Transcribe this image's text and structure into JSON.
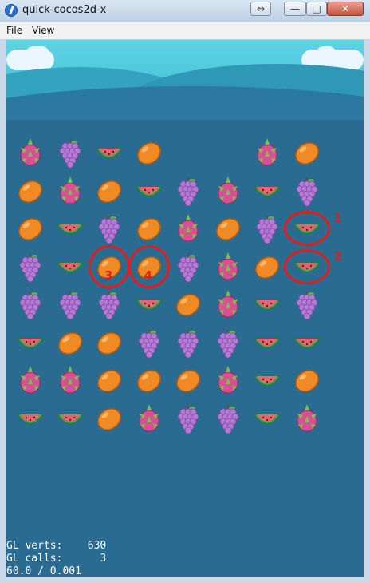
{
  "window": {
    "title": "quick-cocos2d-x",
    "swap_glyph": "⇔",
    "min_glyph": "—",
    "max_glyph": "□",
    "close_glyph": "✕"
  },
  "menu": {
    "items": [
      "File",
      "View"
    ]
  },
  "board": {
    "rows": 8,
    "cols": 8,
    "cells": [
      [
        "dragonfruit",
        "grape",
        "watermelon",
        "mango",
        "empty",
        "empty",
        "dragonfruit",
        "mango"
      ],
      [
        "mango",
        "dragonfruit",
        "mango",
        "watermelon",
        "grape",
        "dragonfruit",
        "watermelon",
        "grape"
      ],
      [
        "mango",
        "watermelon",
        "grape",
        "mango",
        "dragonfruit",
        "mango",
        "grape",
        "watermelon"
      ],
      [
        "grape",
        "watermelon",
        "mango",
        "mango",
        "grape",
        "dragonfruit",
        "mango",
        "watermelon"
      ],
      [
        "grape",
        "grape",
        "grape",
        "watermelon",
        "mango",
        "dragonfruit",
        "watermelon",
        "grape"
      ],
      [
        "watermelon",
        "mango",
        "mango",
        "grape",
        "grape",
        "grape",
        "watermelon",
        "watermelon"
      ],
      [
        "dragonfruit",
        "dragonfruit",
        "mango",
        "mango",
        "mango",
        "dragonfruit",
        "watermelon",
        "mango"
      ],
      [
        "watermelon",
        "watermelon",
        "mango",
        "dragonfruit",
        "grape",
        "grape",
        "watermelon",
        "dragonfruit"
      ]
    ]
  },
  "highlights": [
    {
      "label": "1",
      "row": 2,
      "col": 7
    },
    {
      "label": "2",
      "row": 3,
      "col": 7
    },
    {
      "label": "3",
      "row": 3,
      "col": 2
    },
    {
      "label": "4",
      "row": 3,
      "col": 3
    }
  ],
  "stats": {
    "verts_label": "GL verts:",
    "verts_value": "630",
    "calls_label": "GL calls:",
    "calls_value": "3",
    "fps": "60.0 / 0.001"
  },
  "colors": {
    "highlight": "#e01e1e",
    "sea": "#2a6c91",
    "sky": "#52cbe0"
  }
}
